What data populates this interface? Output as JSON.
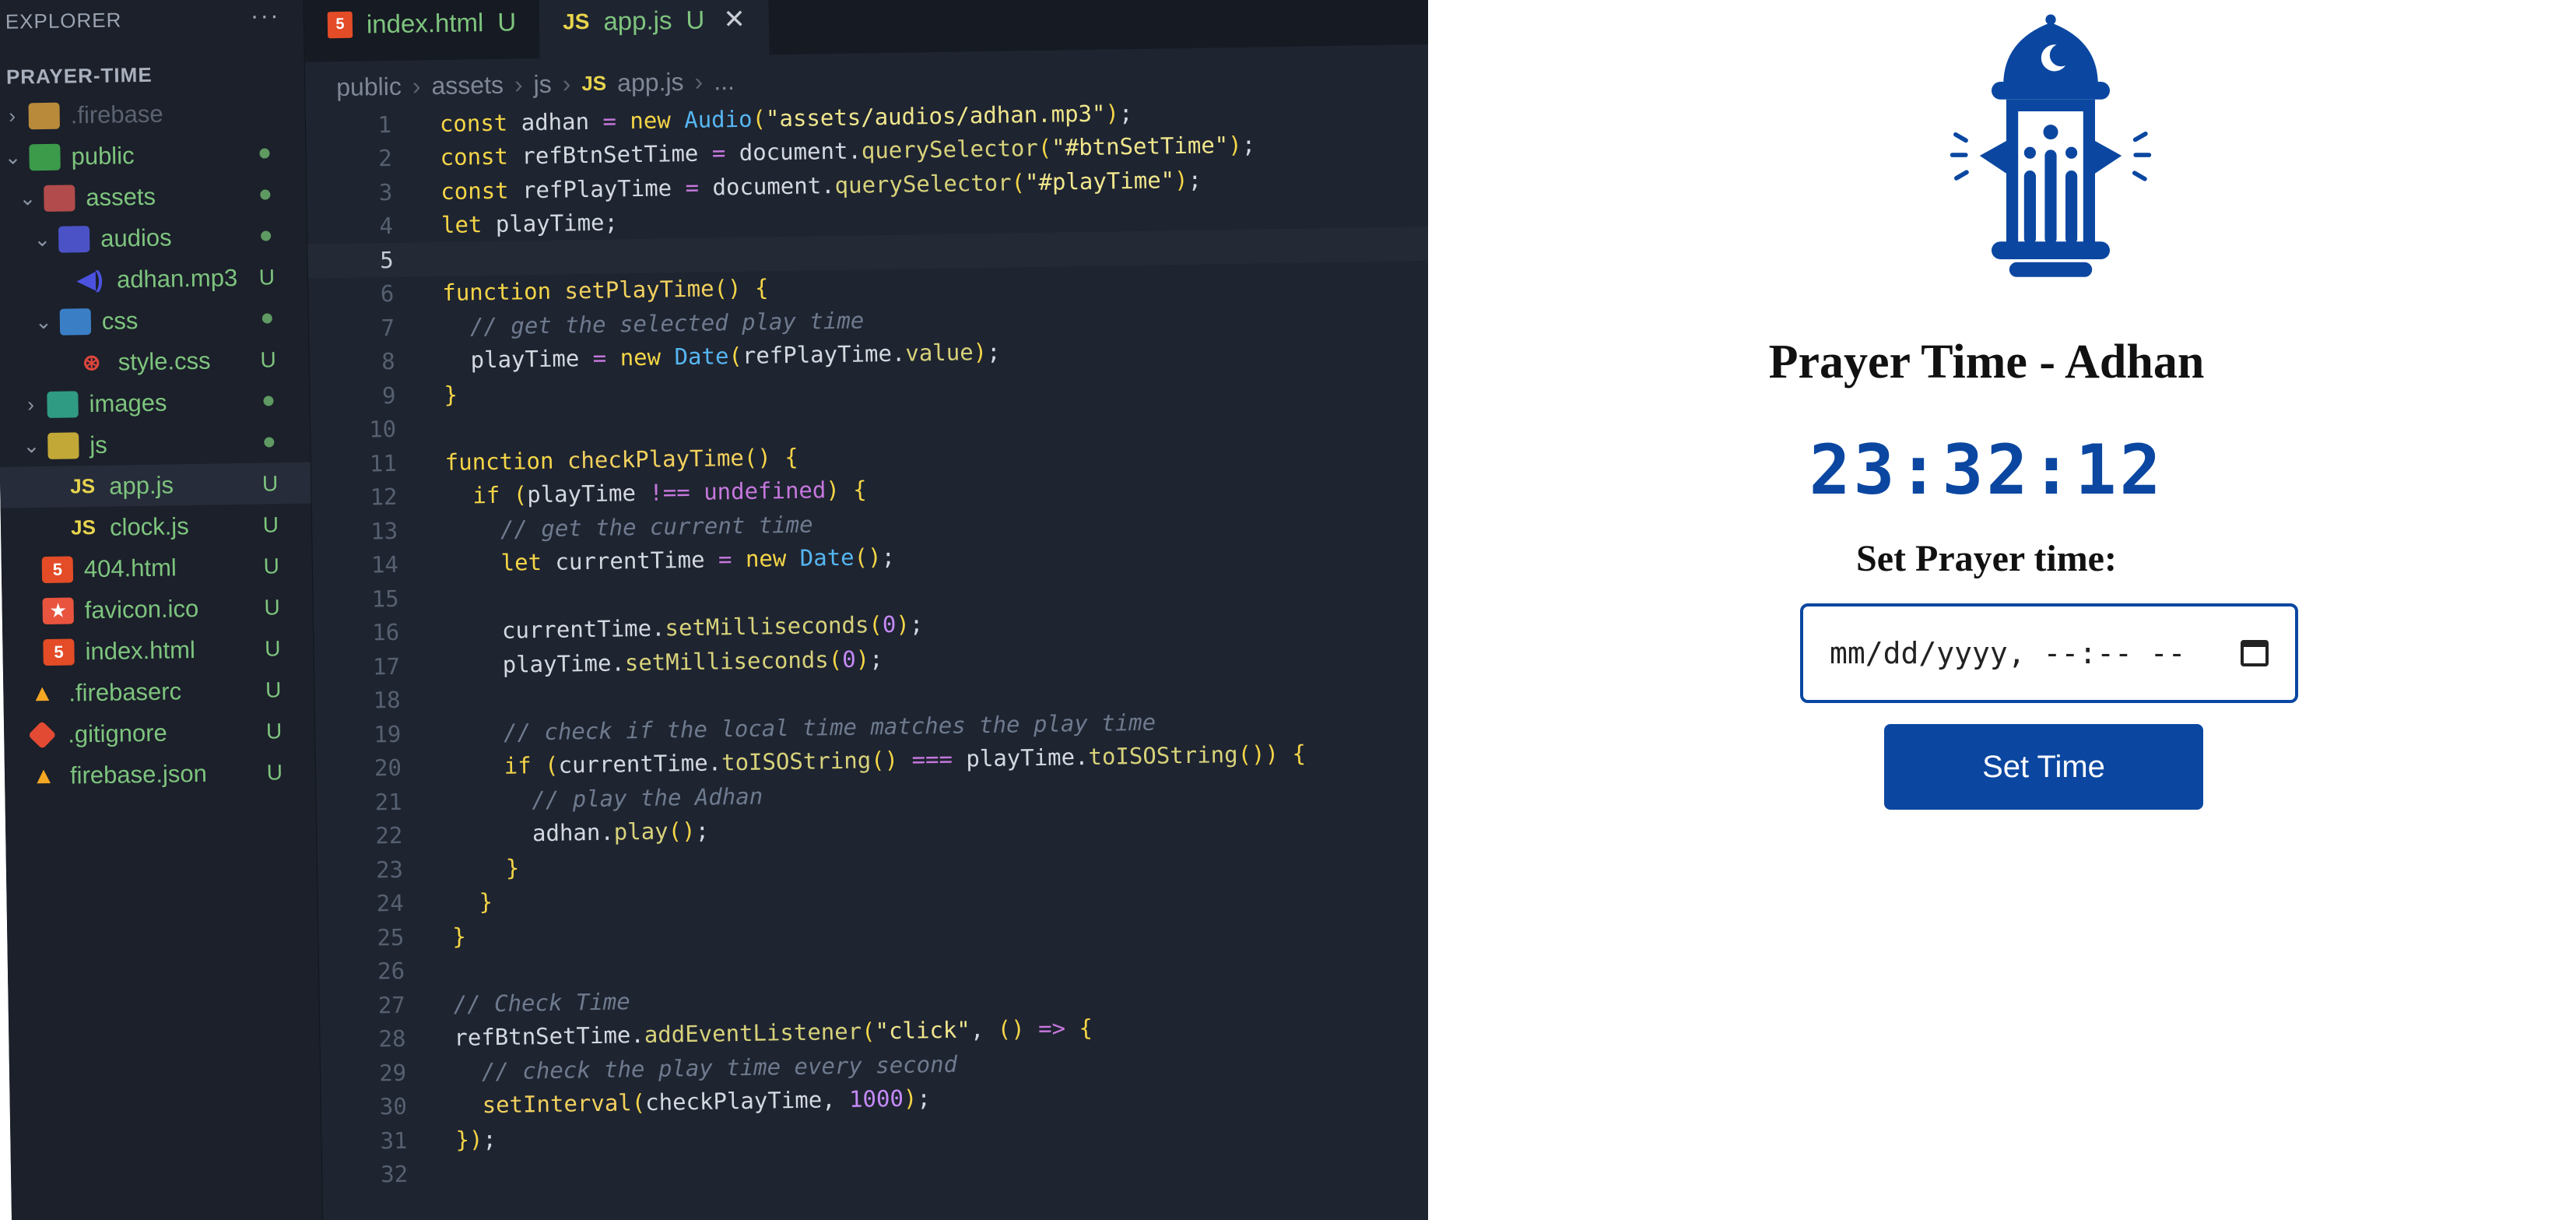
{
  "explorer": {
    "header": "EXPLORER",
    "more": "···",
    "project": "PRAYER-TIME",
    "items": [
      {
        "label": ".firebase",
        "badge": ""
      },
      {
        "label": "public",
        "badge": ""
      },
      {
        "label": "assets",
        "badge": ""
      },
      {
        "label": "audios",
        "badge": ""
      },
      {
        "label": "adhan.mp3",
        "badge": "U"
      },
      {
        "label": "css",
        "badge": ""
      },
      {
        "label": "style.css",
        "badge": "U"
      },
      {
        "label": "images",
        "badge": ""
      },
      {
        "label": "js",
        "badge": ""
      },
      {
        "label": "app.js",
        "badge": "U"
      },
      {
        "label": "clock.js",
        "badge": "U"
      },
      {
        "label": "404.html",
        "badge": "U"
      },
      {
        "label": "favicon.ico",
        "badge": "U"
      },
      {
        "label": "index.html",
        "badge": "U"
      },
      {
        "label": ".firebaserc",
        "badge": "U"
      },
      {
        "label": ".gitignore",
        "badge": "U"
      },
      {
        "label": "firebase.json",
        "badge": "U"
      }
    ]
  },
  "tabs": [
    {
      "label": "index.html",
      "status": "U",
      "icon": "html5-icon"
    },
    {
      "label": "app.js",
      "status": "U",
      "icon": "javascript-icon",
      "close": "✕"
    }
  ],
  "breadcrumb": [
    "public",
    "assets",
    "js",
    "app.js",
    "..."
  ],
  "breadcrumb_js_mark": "JS",
  "editor": {
    "line_numbers": [
      "1",
      "2",
      "3",
      "4",
      "5",
      "6",
      "7",
      "8",
      "9",
      "10",
      "11",
      "12",
      "13",
      "14",
      "15",
      "16",
      "17",
      "18",
      "19",
      "20",
      "21",
      "22",
      "23",
      "24",
      "25",
      "26",
      "27",
      "28",
      "29",
      "30",
      "31",
      "32"
    ],
    "lines": [
      "const adhan = new Audio(\"assets/audios/adhan.mp3\");",
      "const refBtnSetTime = document.querySelector(\"#btnSetTime\");",
      "const refPlayTime = document.querySelector(\"#playTime\");",
      "let playTime;",
      "",
      "function setPlayTime() {",
      "  // get the selected play time",
      "  playTime = new Date(refPlayTime.value);",
      "}",
      "",
      "function checkPlayTime() {",
      "  if (playTime !== undefined) {",
      "    // get the current time",
      "    let currentTime = new Date();",
      "",
      "    currentTime.setMilliseconds(0);",
      "    playTime.setMilliseconds(0);",
      "",
      "    // check if the local time matches the play time",
      "    if (currentTime.toISOString() === playTime.toISOString()) {",
      "      // play the Adhan",
      "      adhan.play();",
      "    }",
      "  }",
      "}",
      "",
      "// Check Time",
      "refBtnSetTime.addEventListener(\"click\", () => {",
      "  // check the play time every second",
      "  setInterval(checkPlayTime, 1000);",
      "});",
      ""
    ]
  },
  "preview": {
    "title": "Prayer Time - Adhan",
    "clock": "23:32:12",
    "set_label": "Set Prayer time:",
    "input_placeholder": "mm/dd/yyyy, --:-- --",
    "button_label": "Set Time",
    "accent_color": "#0b47a1"
  }
}
